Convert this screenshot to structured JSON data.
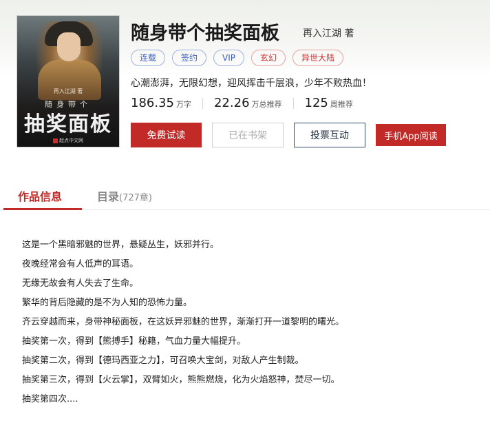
{
  "book": {
    "title": "随身带个抽奖面板",
    "author": "再入江湖 著",
    "cover": {
      "author_line": "再入江湖 著",
      "sub_line": "随身带个",
      "big_line": "抽奖面板",
      "publisher": "起点中文网"
    },
    "tags": [
      {
        "label": "连载",
        "color": "#3a5cc0"
      },
      {
        "label": "签约",
        "color": "#3a5cc0"
      },
      {
        "label": "VIP",
        "color": "#3a5cc0"
      },
      {
        "label": "玄幻",
        "color": "#cf2e2e"
      },
      {
        "label": "异世大陆",
        "color": "#cf2e2e"
      }
    ],
    "intro": "心潮澎湃，无限幻想，迎风挥击千层浪，少年不败热血！",
    "stats": [
      {
        "num": "186.35",
        "unit": "万字"
      },
      {
        "num": "22.26",
        "unit": "万总推荐"
      },
      {
        "num": "125",
        "unit": "周推荐"
      }
    ]
  },
  "actions": {
    "free_read": "免费试读",
    "on_shelf": "已在书架",
    "vote": "投票互动",
    "app_read": "手机App阅读"
  },
  "tabs": {
    "info": "作品信息",
    "catalog": "目录",
    "catalog_count": "(727章)"
  },
  "description": [
    "这是一个黑暗邪魅的世界，悬疑丛生，妖邪并行。",
    "夜晚经常会有人低声的耳语。",
    "无缘无故会有人失去了生命。",
    "繁华的背后隐藏的是不为人知的恐怖力量。",
    "齐云穿越而来，身带神秘面板，在这妖异邪魅的世界，渐渐打开一道黎明的曙光。",
    "抽奖第一次，得到【熊搏手】秘籍，气血力量大幅提升。",
    "抽奖第二次，得到【德玛西亚之力】，可召唤大宝剑，对敌人产生制裁。",
    "抽奖第三次，得到【火云掌】，双臂如火，熊熊燃烧，化为火焰怒神，焚尽一切。",
    "抽奖第四次...."
  ],
  "colors": {
    "accent_red": "#c22a28",
    "tag_blue": "#3a5cc0",
    "vote_border": "#334b6b"
  }
}
